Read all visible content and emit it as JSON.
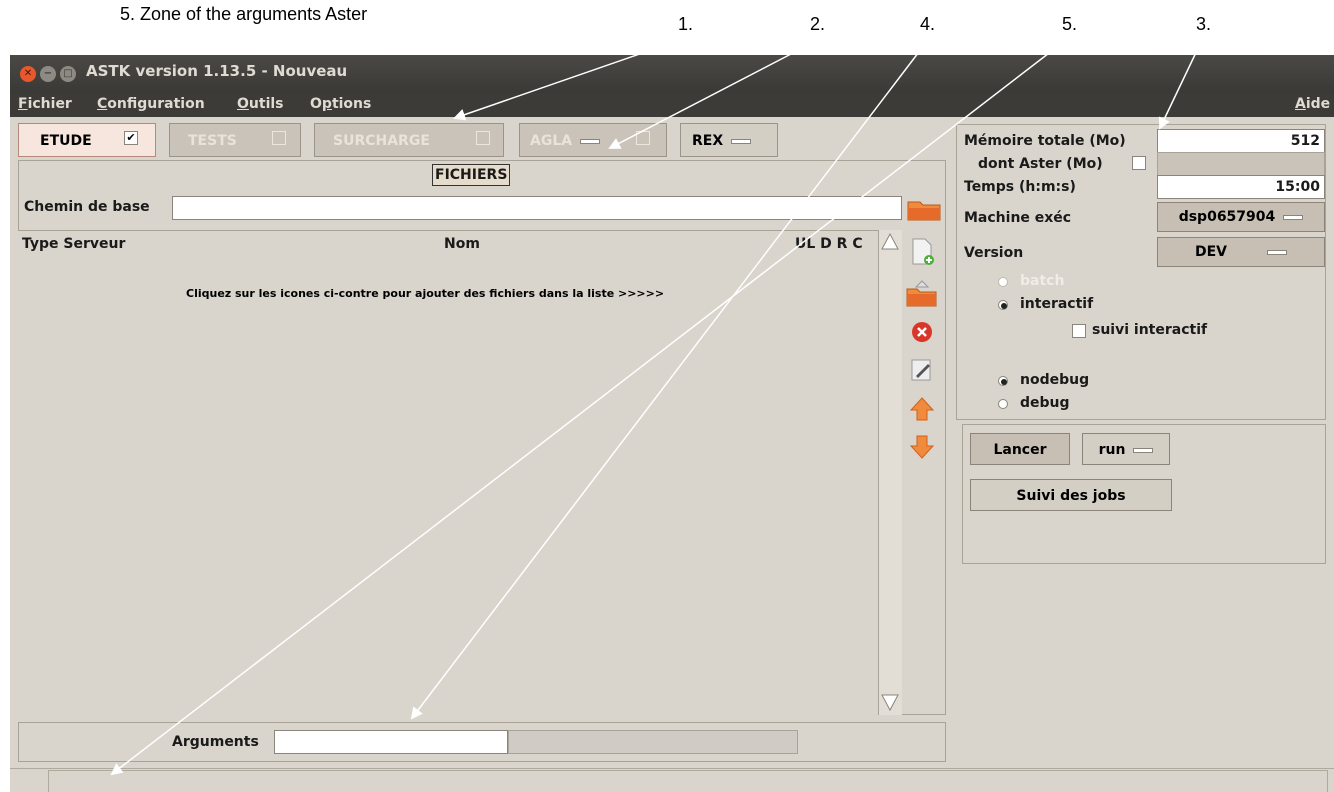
{
  "annotations": {
    "zone_caption": "5.   Zone of the arguments Aster",
    "markers": [
      "1.",
      "2.",
      "4.",
      "5.",
      "3."
    ]
  },
  "window": {
    "title": "ASTK version 1.13.5 - Nouveau",
    "menus": [
      {
        "u": "F",
        "rest": "ichier"
      },
      {
        "u": "C",
        "rest": "onfiguration"
      },
      {
        "u": "O",
        "rest": "utils"
      },
      {
        "pre": "O",
        "u": "p",
        "rest": "tions"
      }
    ],
    "help_menu": {
      "u": "A",
      "rest": "ide"
    }
  },
  "tabs": {
    "etude": "ETUDE",
    "tests": "TESTS",
    "surcharge": "SURCHARGE",
    "agla": "AGLA",
    "rex": "REX",
    "etude_check": "✔"
  },
  "files": {
    "section_title": "FICHIERS",
    "base_path_label": "Chemin de base",
    "base_path_value": "",
    "col_type": "Type Serveur",
    "col_name": "Nom",
    "col_flags": "UL D R C",
    "hint": "Cliquez sur les icones ci-contre pour ajouter des fichiers dans la liste  >>>>>",
    "arguments_label": "Arguments",
    "arguments_value": ""
  },
  "settings": {
    "mem_label": "Mémoire totale (Mo)",
    "mem_value": "512",
    "aster_mem_label": "dont Aster (Mo)",
    "time_label": "Temps (h:m:s)",
    "time_value": "15:00",
    "machine_label": "Machine exéc",
    "machine_value": "dsp0657904",
    "version_label": "Version",
    "version_value": "DEV",
    "batch": "batch",
    "interactif": "interactif",
    "suivi": "suivi interactif",
    "nodebug": "nodebug",
    "debug": "debug"
  },
  "actions": {
    "lancer": "Lancer",
    "run": "run",
    "suivi_jobs": "Suivi des jobs"
  },
  "icons": {
    "close": "✕",
    "minimize": "−",
    "maximize": "□"
  }
}
